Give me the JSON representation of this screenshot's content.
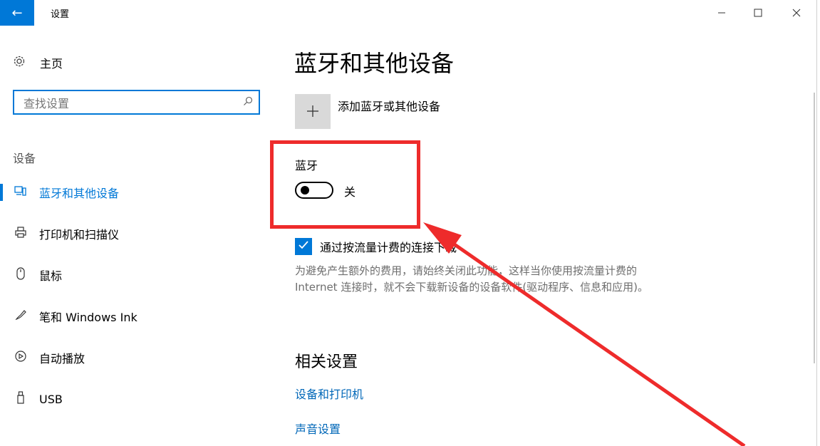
{
  "titlebar": {
    "title": "设置",
    "back_icon": "←",
    "minimize_icon": "—",
    "maximize_icon": "☐",
    "close_icon": "✕"
  },
  "sidebar": {
    "home_label": "主页",
    "search_placeholder": "查找设置",
    "section": "设备",
    "items": [
      {
        "label": "蓝牙和其他设备",
        "icon": "bluetooth-devices-icon",
        "active": true
      },
      {
        "label": "打印机和扫描仪",
        "icon": "printer-icon",
        "active": false
      },
      {
        "label": "鼠标",
        "icon": "mouse-icon",
        "active": false
      },
      {
        "label": "笔和 Windows Ink",
        "icon": "pen-icon",
        "active": false
      },
      {
        "label": "自动播放",
        "icon": "autoplay-icon",
        "active": false
      },
      {
        "label": "USB",
        "icon": "usb-icon",
        "active": false
      }
    ]
  },
  "main": {
    "title": "蓝牙和其他设备",
    "add_device_label": "添加蓝牙或其他设备",
    "bluetooth_label": "蓝牙",
    "bluetooth_state": "关",
    "metered_checkbox_label": "通过按流量计费的连接下载",
    "metered_description": "为避免产生额外的费用，请始终关闭此功能，这样当你使用按流量计费的 Internet 连接时，就不会下载新设备的设备软件(驱动程序、信息和应用)。",
    "related_title": "相关设置",
    "related_links": [
      "设备和打印机",
      "声音设置"
    ]
  },
  "colors": {
    "accent": "#0078d7",
    "annotation": "#ee2b2b"
  }
}
